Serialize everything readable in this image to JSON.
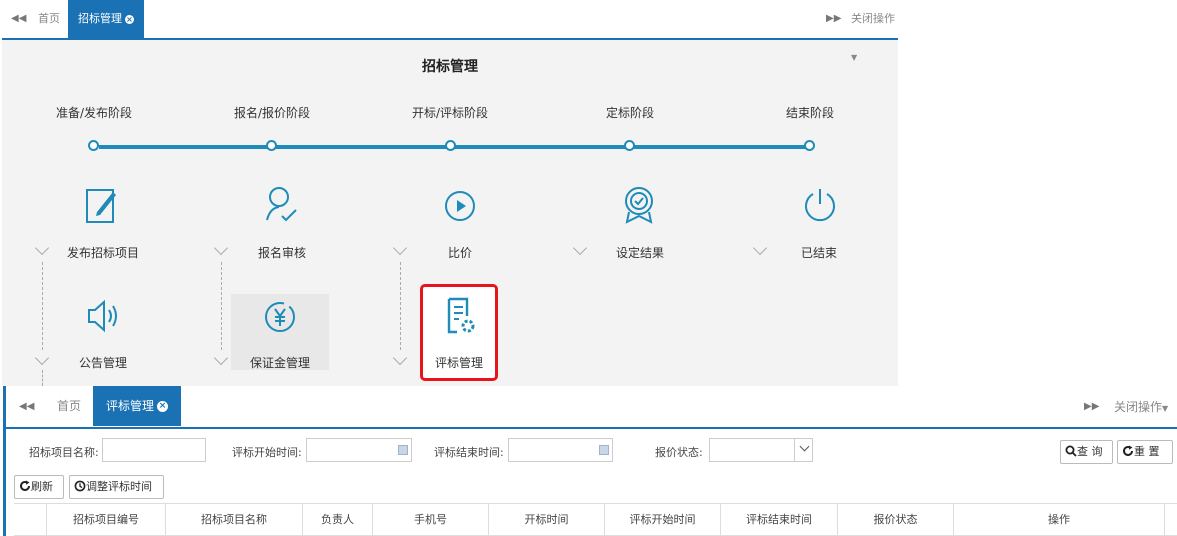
{
  "top": {
    "tabs": {
      "home": "首页",
      "active": "招标管理",
      "close_ops": "关闭操作"
    },
    "title": "招标管理",
    "stages": [
      "准备/发布阶段",
      "报名/报价阶段",
      "开标/评标阶段",
      "定标阶段",
      "结束阶段"
    ],
    "steps_row1": [
      "发布招标项目",
      "报名审核",
      "比价",
      "设定结果",
      "已结束"
    ],
    "steps_row2": [
      "公告管理",
      "保证金管理",
      "评标管理"
    ],
    "accent_color": "#1e8bb8",
    "highlight_color": "#e8141b"
  },
  "bottom": {
    "tabs": {
      "home": "首页",
      "active": "评标管理",
      "close_ops": "关闭操作"
    },
    "filters": {
      "project_name": "招标项目名称:",
      "eval_start": "评标开始时间:",
      "eval_end": "评标结束时间:",
      "quote_status": "报价状态:"
    },
    "buttons": {
      "query": "查 询",
      "reset": "重 置",
      "refresh": "刷新",
      "adjust": "调整评标时间"
    },
    "columns": [
      "招标项目编号",
      "招标项目名称",
      "负责人",
      "手机号",
      "开标时间",
      "评标开始时间",
      "评标结束时间",
      "报价状态",
      "操作"
    ]
  }
}
